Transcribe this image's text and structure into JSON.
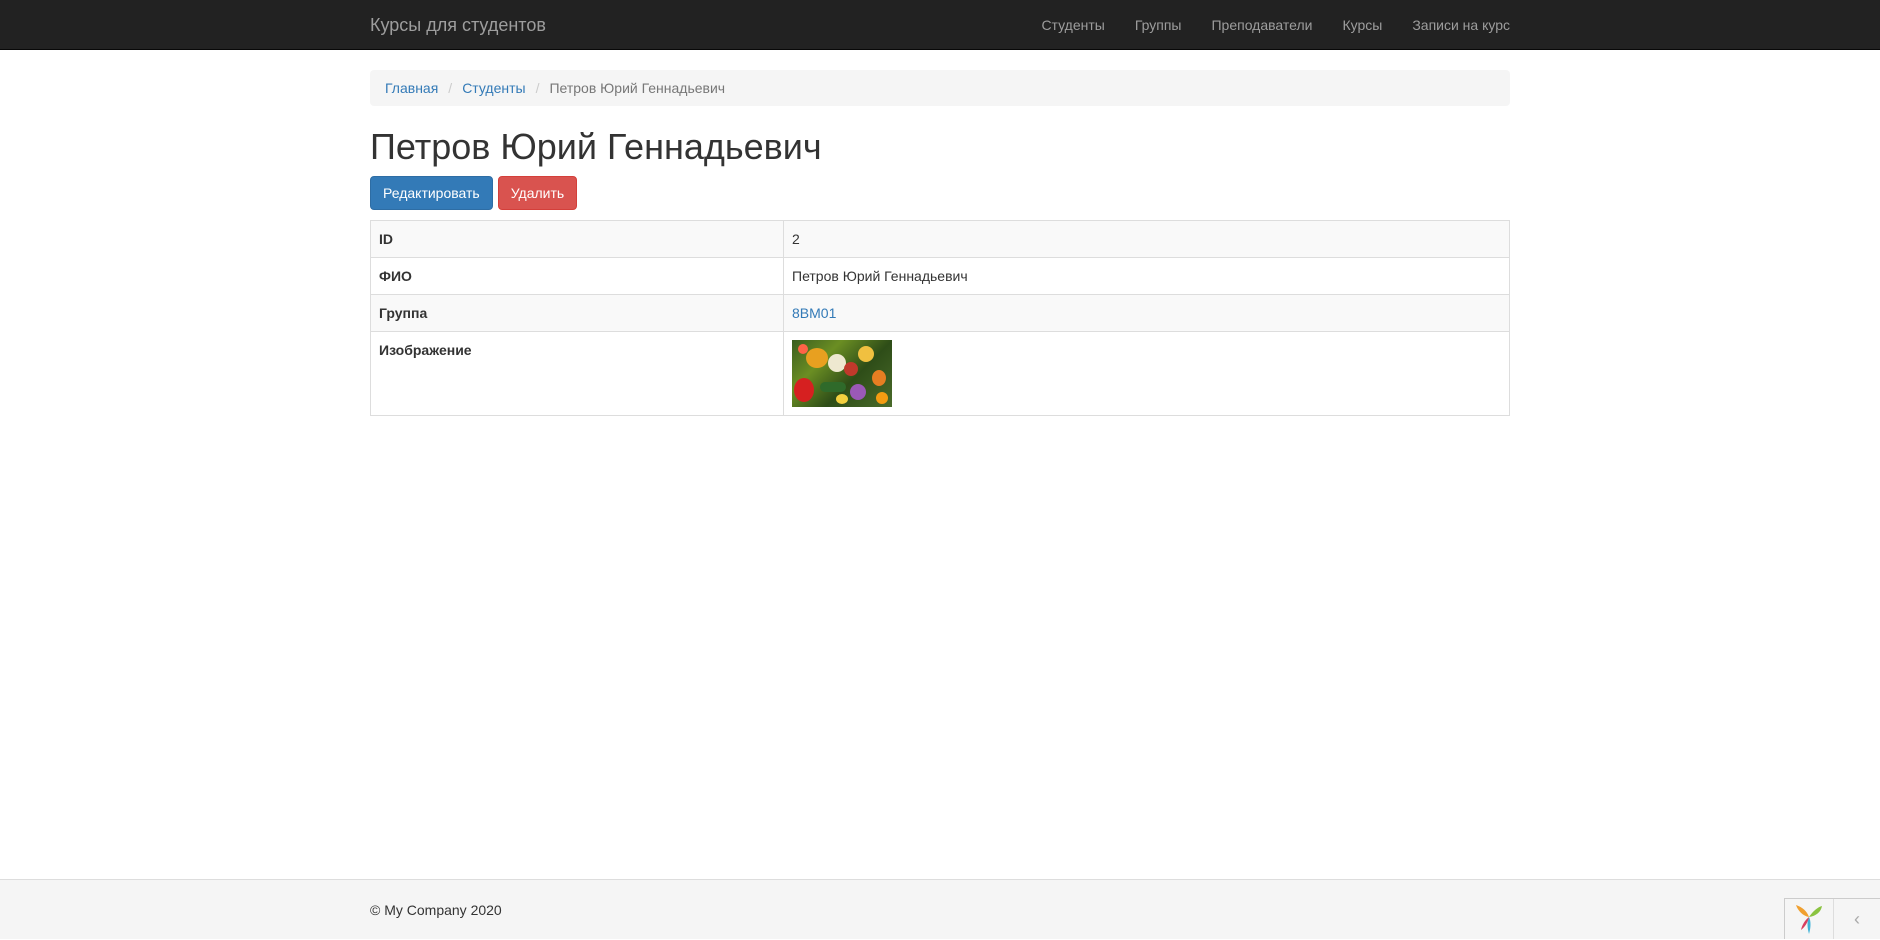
{
  "navbar": {
    "brand": "Курсы для студентов",
    "items": [
      "Студенты",
      "Группы",
      "Преподаватели",
      "Курсы",
      "Записи на курс"
    ]
  },
  "breadcrumb": {
    "home": "Главная",
    "section": "Студенты",
    "current": "Петров Юрий Геннадьевич"
  },
  "page": {
    "title": "Петров Юрий Геннадьевич",
    "edit_label": "Редактировать",
    "delete_label": "Удалить"
  },
  "details": {
    "rows": [
      {
        "label": "ID",
        "value": "2"
      },
      {
        "label": "ФИО",
        "value": "Петров Юрий Геннадьевич"
      },
      {
        "label": "Группа",
        "value": "8ВМ01"
      },
      {
        "label": "Изображение",
        "value": ""
      }
    ]
  },
  "footer": {
    "copyright": "© My Company 2020"
  },
  "debug_toolbar": {
    "logo_icon": "yii-logo-icon",
    "toggle_icon": "chevron-left-icon",
    "toggle_glyph": "‹"
  },
  "colors": {
    "navbar_bg": "#222222",
    "link": "#337ab7",
    "primary": "#337ab7",
    "danger": "#d9534f"
  }
}
